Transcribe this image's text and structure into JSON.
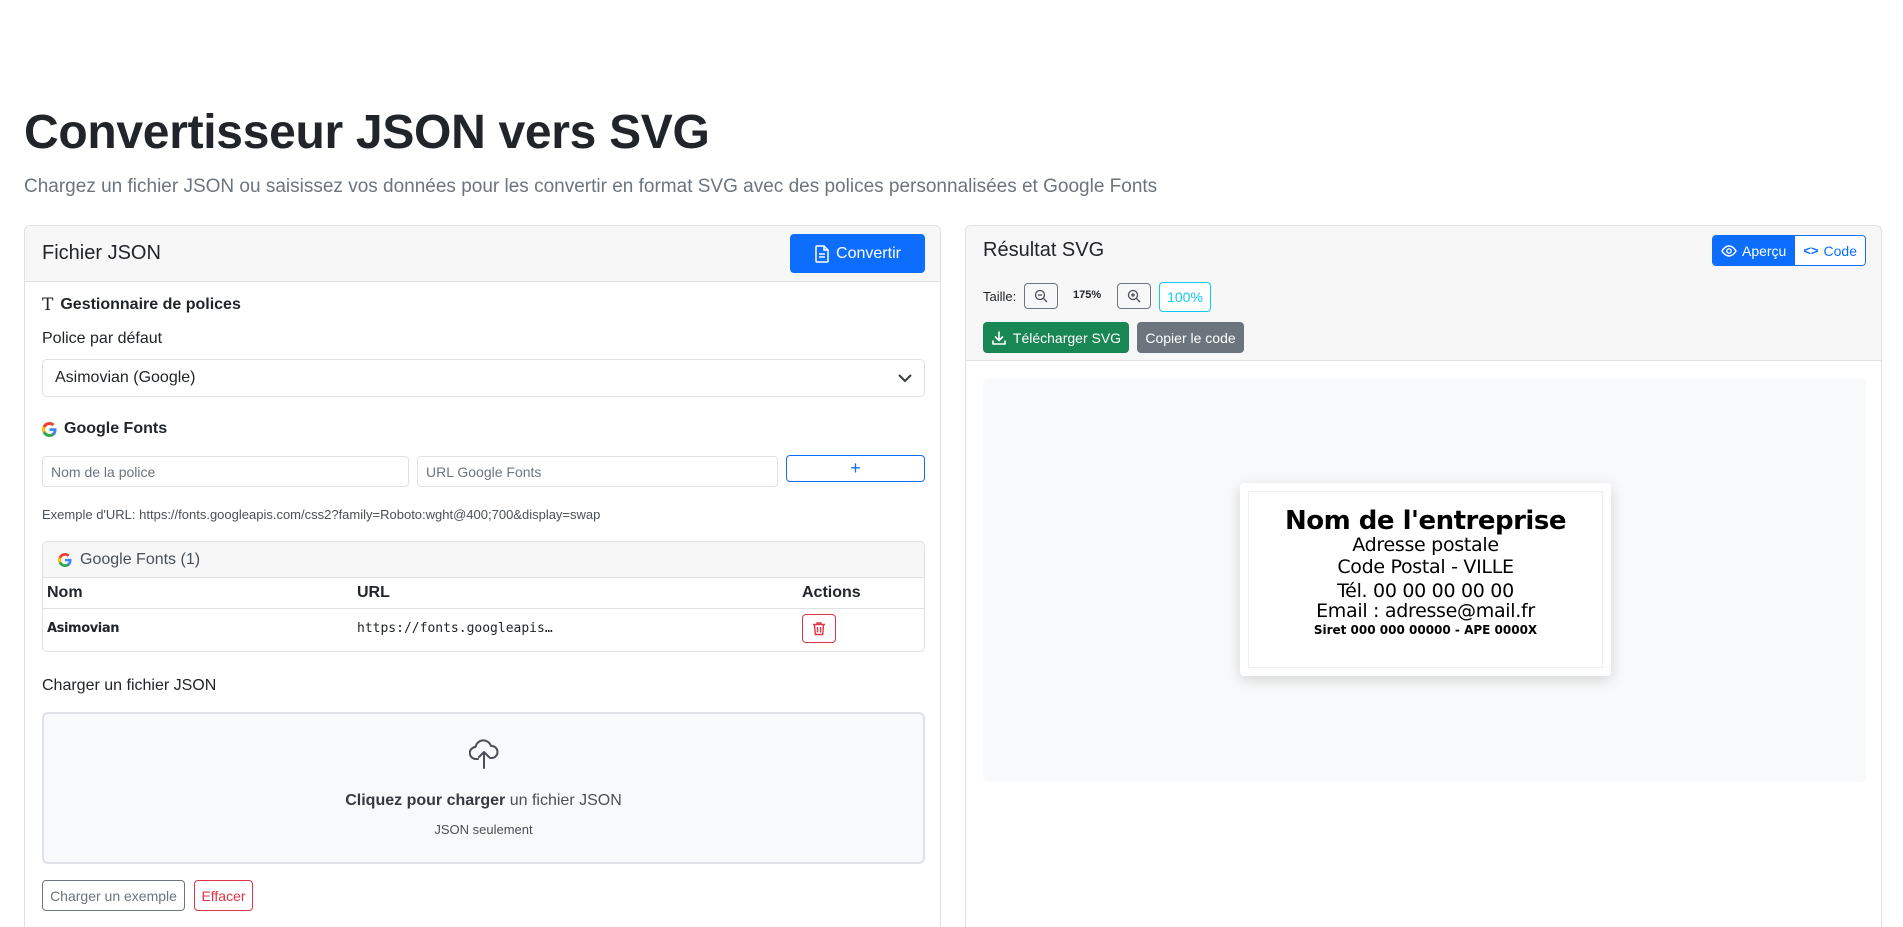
{
  "page": {
    "title": "Convertisseur JSON vers SVG",
    "subtitle": "Chargez un fichier JSON ou saisissez vos données pour les convertir en format SVG avec des polices personnalisées et Google Fonts"
  },
  "left_panel": {
    "title": "Fichier JSON",
    "convert_label": "Convertir",
    "font_manager_title": "Gestionnaire de polices",
    "default_font_label": "Police par défaut",
    "default_font_value": "Asimovian (Google)",
    "google_fonts_title": "Google Fonts",
    "font_name_placeholder": "Nom de la police",
    "font_url_placeholder": "URL Google Fonts",
    "add_label": "+",
    "url_example": "Exemple d'URL: https://fonts.googleapis.com/css2?family=Roboto:wght@400;700&display=swap",
    "fonts_list_title": "Google Fonts (1)",
    "fonts_table": {
      "headers": [
        "Nom",
        "URL",
        "Actions"
      ],
      "rows": [
        {
          "name": "Asimovian",
          "url": "https://fonts.googleapis…"
        }
      ]
    },
    "upload_label": "Charger un fichier JSON",
    "dropzone_bold": "Cliquez pour charger",
    "dropzone_text": "un fichier JSON",
    "dropzone_sub": "JSON seulement",
    "example_label": "Charger un exemple",
    "clear_label": "Effacer"
  },
  "right_panel": {
    "title": "Résultat SVG",
    "preview_tab": "Aperçu",
    "code_tab": "Code",
    "size_label": "Taille:",
    "zoom_value": "175%",
    "reset_label": "100%",
    "download_label": "Télécharger SVG",
    "copy_label": "Copier le code",
    "svg_lines": [
      "Nom de l'entreprise",
      "Adresse postale",
      "Code Postal - VILLE",
      "Tél. 00 00 00 00 00",
      "Email : adresse@mail.fr",
      "Siret 000 000 00000 - APE 0000X"
    ]
  },
  "colors": {
    "primary": "#0d6efd",
    "success": "#198754",
    "secondary": "#6c757d",
    "danger": "#dc3545",
    "info": "#0dcaf0"
  }
}
